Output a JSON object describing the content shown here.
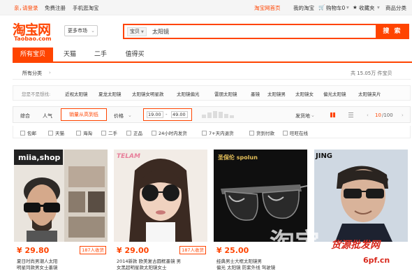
{
  "topbar": {
    "login_prefix": "亲，",
    "login": "请登录",
    "register": "免费注册",
    "mobile": "手机逛淘宝",
    "home": "淘宝网首页",
    "my_taobao": "我的淘宝",
    "cart": "购物车0",
    "favorites": "收藏夹",
    "categories": "商品分类"
  },
  "logo": {
    "cn": "淘宝网",
    "en": "Taobao.com"
  },
  "header": {
    "more_market": "更多市场",
    "search_scope": "宝贝",
    "search_value": "太阳镜",
    "search_button": "搜 索"
  },
  "tabs": [
    "所有宝贝",
    "天猫",
    "二手",
    "值得买"
  ],
  "category": {
    "all": "所有分类",
    "result_count": "共 15.05万 件宝贝"
  },
  "suggest": {
    "label": "您是不是想找:",
    "items": [
      "近视太阳镜",
      "夏龙太阳镜",
      "太阳镜女明星款",
      "太阳镜偏光",
      "雷朋太阳镜",
      "墨镜",
      "太阳镜男",
      "太阳镜女",
      "偏光太阳镜",
      "太阳镜夹片"
    ]
  },
  "sort": {
    "general": "综合",
    "popularity": "人气",
    "sales": "销量从高到低",
    "price": "价格",
    "price_min": "19.00",
    "price_max": "49.00",
    "ship_from": "发货地",
    "page": "10",
    "page_total": "/100"
  },
  "filters": [
    "包邮",
    "天猫",
    "海淘",
    "二手",
    "正品",
    "24小时内发货",
    "7+天内退货",
    "货到付款",
    "旺旺在线"
  ],
  "products": [
    {
      "price": "¥ 29.80",
      "sold": "187人收货",
      "title_a": "夏日时尚男潮人太阳",
      "title_b": "明星同款男女士墨镜",
      "logo_label": "miia,shop"
    },
    {
      "price": "¥ 29.00",
      "sold": "187人收货",
      "title_a": "2014新款 欧美复古圆框墨镜 男",
      "title_b": "女黑超明星款太阳镜女士",
      "logo_label": "TELAM"
    },
    {
      "price": "¥ 25.00",
      "sold": "",
      "title_a": "经典男士大框太阳镜男",
      "title_b": "偏光 太阳镜 防紫外线 驾驶镜",
      "logo_label": "圣保伦 spolun"
    },
    {
      "price": "",
      "sold": "",
      "title_a": "",
      "title_b": "",
      "logo_label": "JING"
    }
  ],
  "watermark": {
    "main": "淘宝",
    "sub": "货源批发网",
    "url": "6pf.cn"
  },
  "colors": {
    "accent": "#ff4400"
  }
}
